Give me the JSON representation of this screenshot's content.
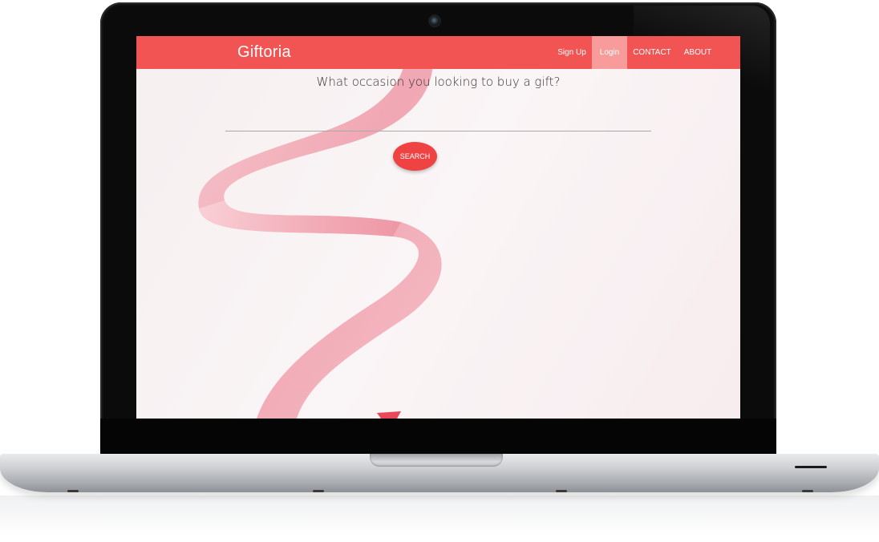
{
  "site": {
    "brand": "Giftoria"
  },
  "nav": {
    "items": [
      {
        "label": "Sign Up",
        "active": false
      },
      {
        "label": "Login",
        "active": true
      },
      {
        "label": "CONTACT",
        "active": false
      },
      {
        "label": "ABOUT",
        "active": false
      }
    ]
  },
  "main": {
    "question": "What occasion you looking to buy a gift?",
    "search_value": "",
    "search_button": "SEARCH"
  },
  "colors": {
    "navbar": "#f25454",
    "nav_active": "#f79b9b",
    "button": "#ef4343",
    "ribbon": "#f2a3ae"
  },
  "device": {
    "icons": [
      "camera-icon",
      "ribbon-image"
    ]
  }
}
